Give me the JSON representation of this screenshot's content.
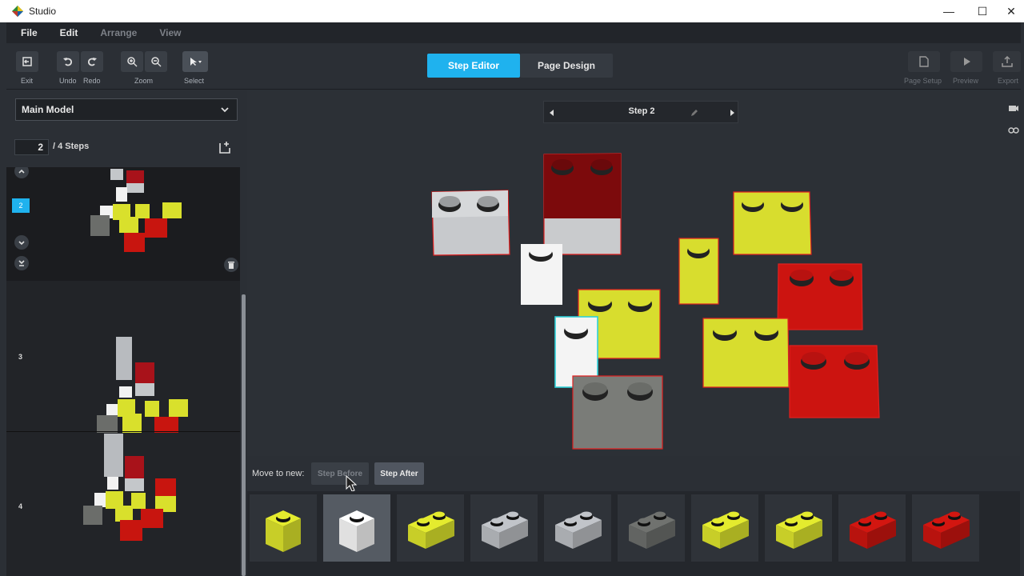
{
  "window": {
    "title": "Studio",
    "minimize_glyph": "—",
    "maximize_glyph": "☐",
    "close_glyph": "✕"
  },
  "menu": [
    "File",
    "Edit",
    "Arrange",
    "View"
  ],
  "toolbar": {
    "exit": "Exit",
    "undo": "Undo",
    "redo": "Redo",
    "zoom": "Zoom",
    "select": "Select",
    "page_setup": "Page Setup",
    "preview": "Preview",
    "export": "Export"
  },
  "tabs": {
    "step_editor": "Step Editor",
    "page_design": "Page Design"
  },
  "sidebar": {
    "model": "Main Model",
    "current_step": "2",
    "total_steps": "/ 4 Steps",
    "thumbnails": [
      {
        "num": "2",
        "selected": true
      },
      {
        "num": "3",
        "selected": false
      },
      {
        "num": "4",
        "selected": false
      }
    ]
  },
  "step_nav": {
    "label": "Step 2"
  },
  "move_bar": {
    "label": "Move to new:",
    "step_before": "Step Before",
    "step_after": "Step After"
  },
  "colors": {
    "accent": "#1fb2ee",
    "yellow": "#d9e02c",
    "red": "#c8150f",
    "dark_red": "#7a0a0a",
    "white": "#f4f4f4",
    "light_gray": "#b8bbbf",
    "dark_gray": "#6b6d6a"
  },
  "parts": [
    {
      "name": "yellow-1x1-brick",
      "color": "#d9e02c",
      "studs": 1
    },
    {
      "name": "white-1x1-brick",
      "color": "#f4f4f4",
      "studs": 1
    },
    {
      "name": "yellow-1x2-brick",
      "color": "#d9e02c",
      "studs": 2
    },
    {
      "name": "light-gray-1x2-brick",
      "color": "#b8bbbf",
      "studs": 2
    },
    {
      "name": "light-gray-1x2-brick",
      "color": "#b8bbbf",
      "studs": 2
    },
    {
      "name": "dark-gray-1x2-brick",
      "color": "#6b6d6a",
      "studs": 2
    },
    {
      "name": "yellow-1x2-brick",
      "color": "#d9e02c",
      "studs": 2
    },
    {
      "name": "yellow-1x2-brick",
      "color": "#d9e02c",
      "studs": 2
    },
    {
      "name": "red-1x2-brick",
      "color": "#c8150f",
      "studs": 2
    },
    {
      "name": "red-1x2-brick",
      "color": "#c8150f",
      "studs": 2
    }
  ]
}
